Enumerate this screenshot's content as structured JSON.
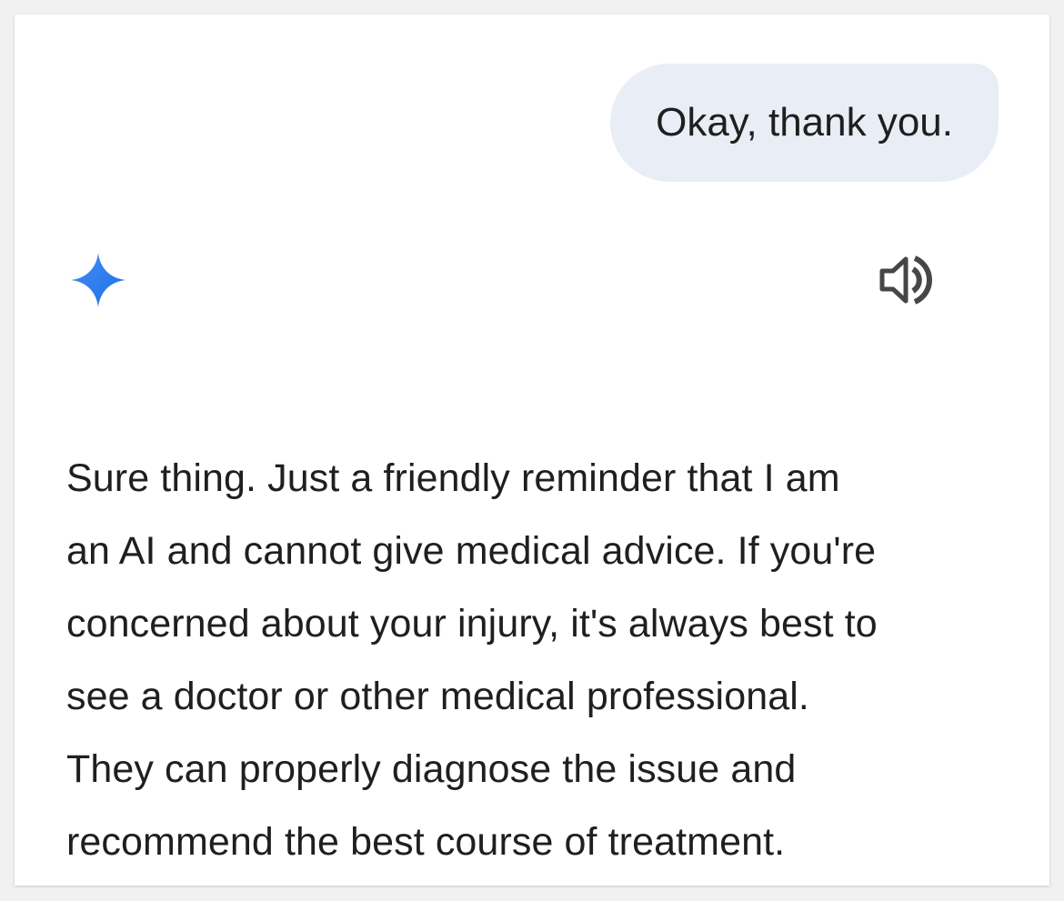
{
  "conversation": {
    "user_message": "Okay, thank you.",
    "assistant_icon": "gemini-sparkle-icon",
    "speaker_icon": "volume-speaker-icon",
    "response_lines": [
      "Sure thing. Just a friendly reminder that I am",
      "an AI and cannot give medical advice. If you're",
      "concerned about your injury, it's always best to",
      "see a doctor or other medical professional.",
      "They can properly diagnose the issue and",
      "recommend the best course of treatment."
    ]
  },
  "colors": {
    "user_bubble_bg": "#e9eef6",
    "sparkle_start": "#4285f4",
    "sparkle_end": "#1a73e8",
    "text": "#1f1f1f",
    "icon": "#444746"
  }
}
